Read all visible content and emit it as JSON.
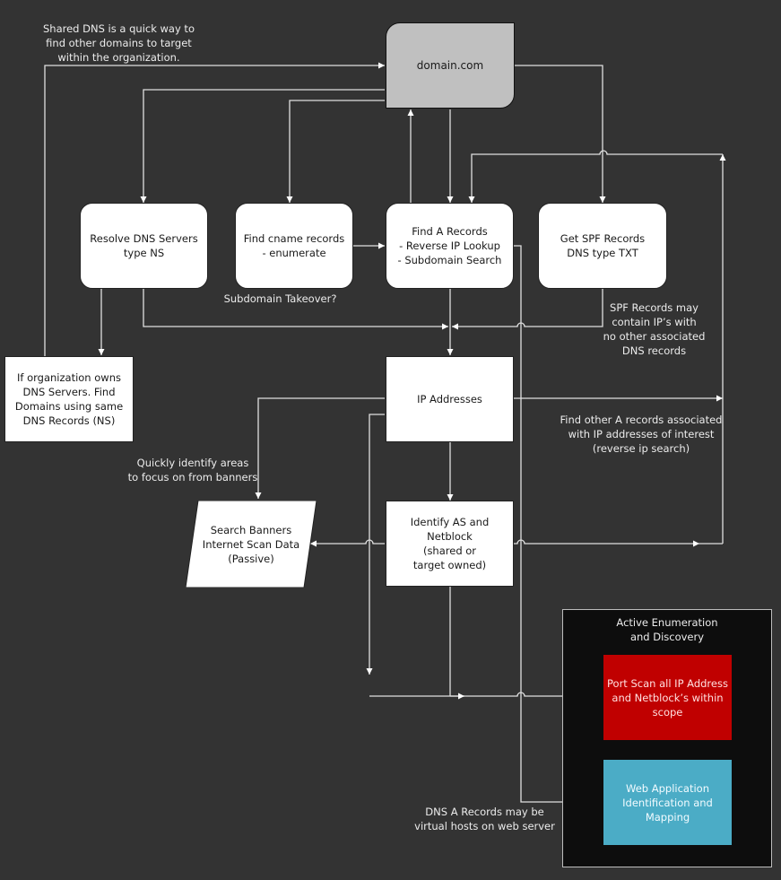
{
  "diagram": {
    "nodes": {
      "domain": "domain.com",
      "resolve_dns": "Resolve DNS Servers\ntype NS",
      "find_cname": "Find cname records\n- enumerate",
      "find_a": "Find A Records\n- Reverse IP Lookup\n- Subdomain Search",
      "get_spf": "Get SPF Records\nDNS type TXT",
      "org_owns_dns": "If organization owns\nDNS Servers. Find\nDomains using same\nDNS Records (NS)",
      "ip_addresses": "IP Addresses",
      "search_banners": "Search Banners\nInternet Scan Data\n(Passive)",
      "identify_as": "Identify AS and\nNetblock\n(shared or\ntarget owned)",
      "port_scan": "Port Scan all IP Address\nand Netblock’s within\nscope",
      "web_app": "Web Application\nIdentification and\nMapping"
    },
    "group": {
      "title": "Active Enumeration\nand Discovery"
    },
    "notes": {
      "shared_dns": "Shared DNS is a quick way to\nfind other domains to target\nwithin the organization.",
      "subdomain_takeover": "Subdomain Takeover?",
      "spf_note": "SPF Records may\ncontain IP’s with\nno other associated\nDNS records",
      "find_other_a": "Find other A records associated\nwith IP addresses of interest\n(reverse ip search)",
      "banners_note": "Quickly identify areas\nto focus on from banners",
      "vhosts_note": "DNS A Records may be\nvirtual hosts on web server"
    },
    "colors": {
      "background": "#333333",
      "domain_fill": "#c0c0c0",
      "port_scan_fill": "#c00000",
      "web_app_fill": "#4bacc6",
      "group_fill": "#0d0d0d",
      "connector": "#e6e6e6"
    }
  }
}
